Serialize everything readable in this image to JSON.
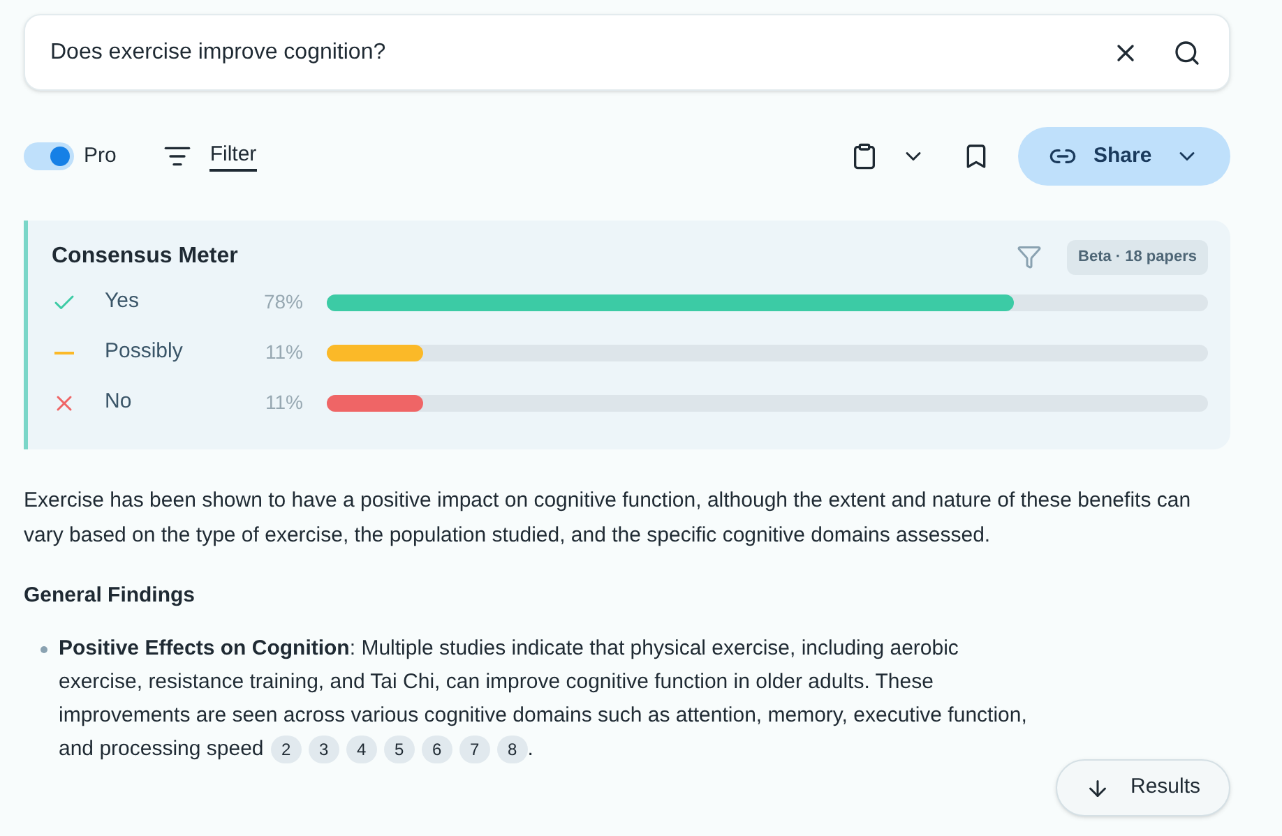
{
  "search": {
    "value": "Does exercise improve cognition?"
  },
  "toolbar": {
    "pro": {
      "label": "Pro",
      "on": true
    },
    "filter": {
      "label": "Filter"
    },
    "share": {
      "label": "Share"
    }
  },
  "consensus": {
    "title": "Consensus Meter",
    "badge": "Beta · 18 papers",
    "rows": [
      {
        "kind": "yes",
        "label": "Yes",
        "percent": "78%",
        "level": 0.78,
        "color": "#3ccba5"
      },
      {
        "kind": "possibly",
        "label": "Possibly",
        "percent": "11%",
        "level": 0.11,
        "color": "#fbb928"
      },
      {
        "kind": "no",
        "label": "No",
        "percent": "11%",
        "level": 0.11,
        "color": "#ef6566"
      }
    ]
  },
  "summary": "Exercise has been shown to have a positive impact on cognitive function, although the extent and nature of these benefits can vary based on the type of exercise, the population studied, and the specific cognitive domains assessed.",
  "section_heading": "General Findings",
  "findings": [
    {
      "text": "**Positive Effects on Cognition**: Multiple studies indicate that physical exercise, including aerobic exercise, resistance training, and Tai Chi, can improve cognitive function in older adults. These improvements are seen across various cognitive domains such as attention, memory, executive function, and processing speed",
      "citations": [
        "2",
        "3",
        "4",
        "5",
        "6",
        "7",
        "8"
      ],
      "end": "."
    }
  ],
  "results_button": {
    "label": "Results"
  }
}
